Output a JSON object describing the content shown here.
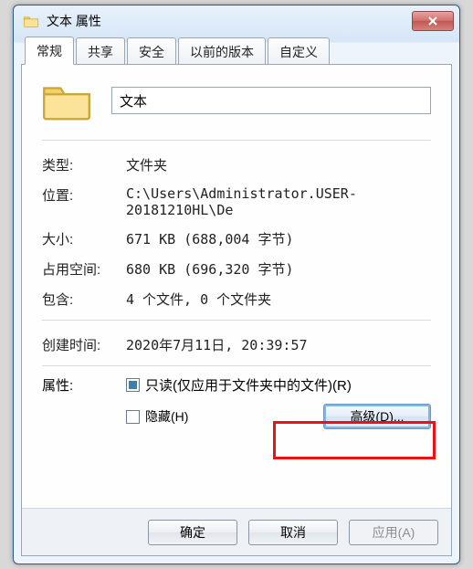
{
  "window": {
    "title": "文本 属性"
  },
  "tabs": {
    "general": "常规",
    "sharing": "共享",
    "security": "安全",
    "previous": "以前的版本",
    "custom": "自定义"
  },
  "folder": {
    "name": "文本"
  },
  "labels": {
    "type": "类型:",
    "location": "位置:",
    "size": "大小:",
    "size_on_disk": "占用空间:",
    "contains": "包含:",
    "created": "创建时间:",
    "attributes": "属性:"
  },
  "values": {
    "type": "文件夹",
    "location": "C:\\Users\\Administrator.USER-20181210HL\\De",
    "size": "671 KB (688,004 字节)",
    "size_on_disk": "680 KB (696,320 字节)",
    "contains": "4 个文件, 0 个文件夹",
    "created": "2020年7月11日, 20:39:57"
  },
  "attributes": {
    "readonly_label": "只读(仅应用于文件夹中的文件)(R)",
    "hidden_label": "隐藏(H)",
    "advanced_button": "高级(D)..."
  },
  "buttons": {
    "ok": "确定",
    "cancel": "取消",
    "apply": "应用(A)"
  }
}
